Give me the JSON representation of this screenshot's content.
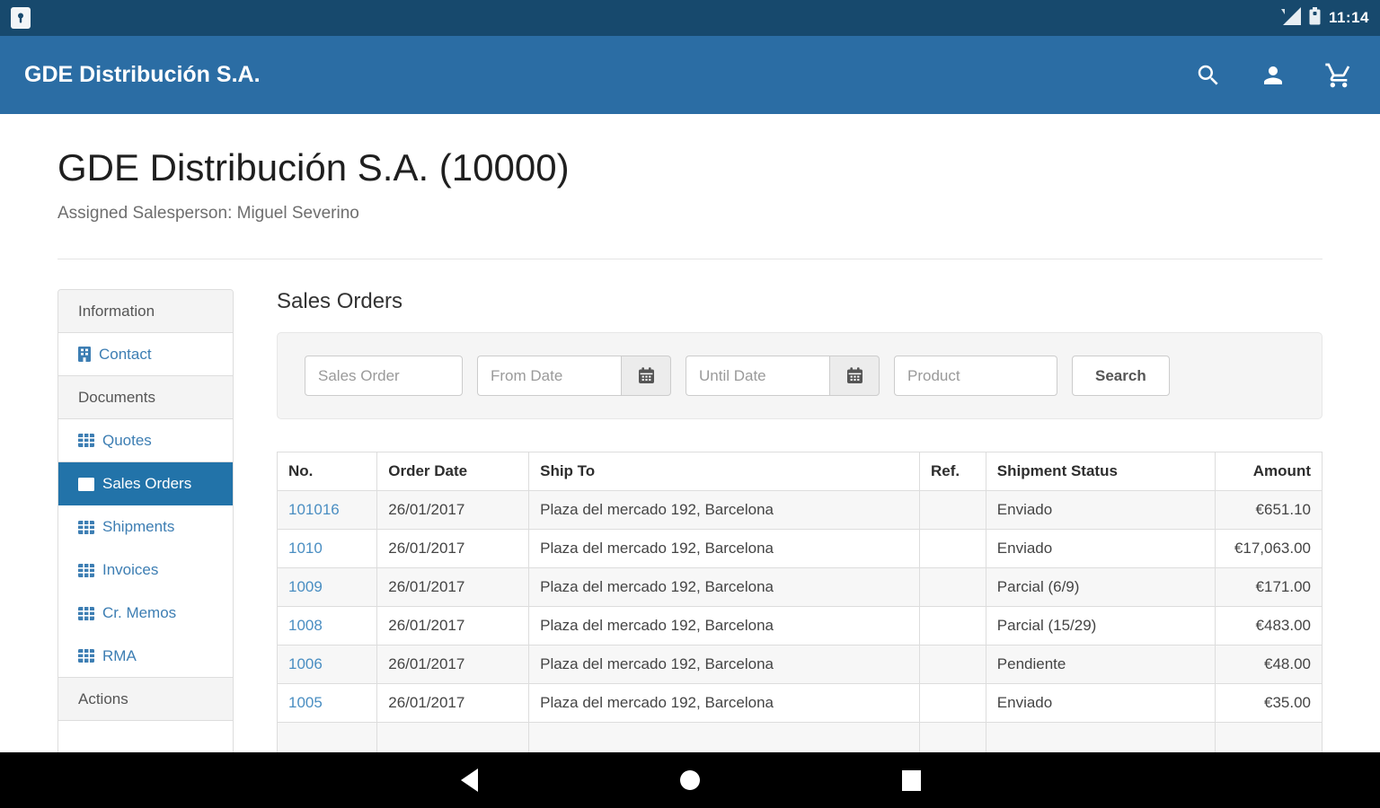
{
  "status_bar": {
    "time": "11:14"
  },
  "app_bar": {
    "title": "GDE Distribución S.A."
  },
  "page": {
    "title": "GDE Distribución S.A. (10000)",
    "subtitle": "Assigned Salesperson: Miguel Severino"
  },
  "sidebar": {
    "items": [
      {
        "label": "Information",
        "type": "header"
      },
      {
        "label": "Contact",
        "type": "link",
        "icon": "building-icon",
        "selected": false
      },
      {
        "label": "Documents",
        "type": "header"
      },
      {
        "label": "Quotes",
        "type": "link",
        "icon": "table-icon",
        "selected": false
      },
      {
        "label": "Sales Orders",
        "type": "link",
        "icon": "table-icon",
        "selected": true
      },
      {
        "label": "Shipments",
        "type": "link",
        "icon": "table-icon",
        "selected": false
      },
      {
        "label": "Invoices",
        "type": "link",
        "icon": "table-icon",
        "selected": false
      },
      {
        "label": "Cr. Memos",
        "type": "link",
        "icon": "table-icon",
        "selected": false
      },
      {
        "label": "RMA",
        "type": "link",
        "icon": "table-icon",
        "selected": false
      },
      {
        "label": "Actions",
        "type": "header"
      }
    ]
  },
  "main": {
    "heading": "Sales Orders",
    "filters": {
      "sales_order_placeholder": "Sales Order",
      "from_date_placeholder": "From Date",
      "until_date_placeholder": "Until Date",
      "product_placeholder": "Product",
      "search_label": "Search"
    },
    "table": {
      "columns": [
        "No.",
        "Order Date",
        "Ship To",
        "Ref.",
        "Shipment Status",
        "Amount"
      ],
      "rows": [
        {
          "no": "101016",
          "order_date": "26/01/2017",
          "ship_to": "Plaza del mercado 192, Barcelona",
          "ref": "",
          "status": "Enviado",
          "amount": "€651.10"
        },
        {
          "no": "1010",
          "order_date": "26/01/2017",
          "ship_to": "Plaza del mercado 192, Barcelona",
          "ref": "",
          "status": "Enviado",
          "amount": "€17,063.00"
        },
        {
          "no": "1009",
          "order_date": "26/01/2017",
          "ship_to": "Plaza del mercado 192, Barcelona",
          "ref": "",
          "status": "Parcial (6/9)",
          "amount": "€171.00"
        },
        {
          "no": "1008",
          "order_date": "26/01/2017",
          "ship_to": "Plaza del mercado 192, Barcelona",
          "ref": "",
          "status": "Parcial (15/29)",
          "amount": "€483.00"
        },
        {
          "no": "1006",
          "order_date": "26/01/2017",
          "ship_to": "Plaza del mercado 192, Barcelona",
          "ref": "",
          "status": "Pendiente",
          "amount": "€48.00"
        },
        {
          "no": "1005",
          "order_date": "26/01/2017",
          "ship_to": "Plaza del mercado 192, Barcelona",
          "ref": "",
          "status": "Enviado",
          "amount": "€35.00"
        }
      ]
    }
  },
  "colors": {
    "status_bar": "#17496d",
    "app_bar": "#2b6da4",
    "selected_item": "#2273a9",
    "link": "#4a8ec2",
    "stripe": "#f7f7f7"
  }
}
